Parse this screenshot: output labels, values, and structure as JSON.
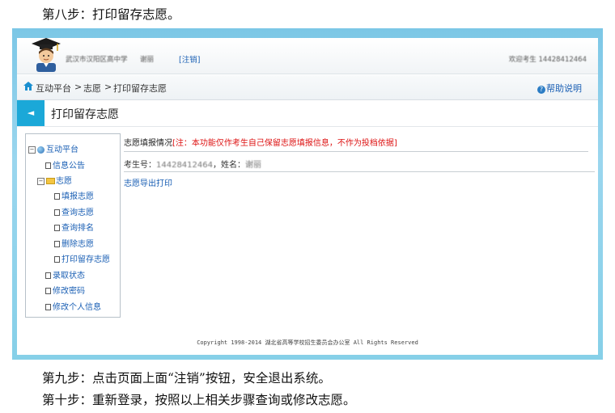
{
  "doc": {
    "step8": "第八步：打印留存志愿。",
    "step9": "第九步：点击页面上面“注销”按钮，安全退出系统。",
    "step10": "第十步：重新登录，按照以上相关步骤查询或修改志愿。"
  },
  "header": {
    "school_blurred": "武汉市汉阳区高中学",
    "name_blurred": "谢丽",
    "logout_label": "[注销]",
    "right_blurred": "欢迎考生 14428412464"
  },
  "breadcrumb": {
    "home": "互动平台",
    "sep1": ">",
    "level2": "志愿",
    "sep2": ">",
    "level3": "打印留存志愿",
    "help": "帮助说明",
    "help_icon_glyph": "?"
  },
  "titlebar": {
    "back_glyph": "◄",
    "title": "打印留存志愿"
  },
  "tree": {
    "root": "互动平台",
    "info": "信息公告",
    "wish": "志愿",
    "fill": "填报志愿",
    "query": "查询志愿",
    "rank": "查询排名",
    "delete": "删除志愿",
    "print": "打印留存志愿",
    "admission": "录取状态",
    "password": "修改密码",
    "profile": "修改个人信息",
    "expand_minus": "−"
  },
  "content": {
    "status_label": "志愿填报情况",
    "status_note": "[注：本功能仅作考生自己保留志愿填报信息，不作为投档依据]",
    "student_no_label": "考生号：",
    "student_no_blurred": "14428412464",
    "name_label": "，姓名：",
    "name_blurred": "谢丽",
    "export_link": "志愿导出打印"
  },
  "footer": {
    "copyright": "Copyright 1998-2014 湖北省高等学校招生委员会办公室 All Rights Reserved"
  },
  "colors": {
    "accent_blue": "#1ba8d8",
    "link_blue": "#1a5fb4",
    "warning_red": "#dd1111"
  }
}
